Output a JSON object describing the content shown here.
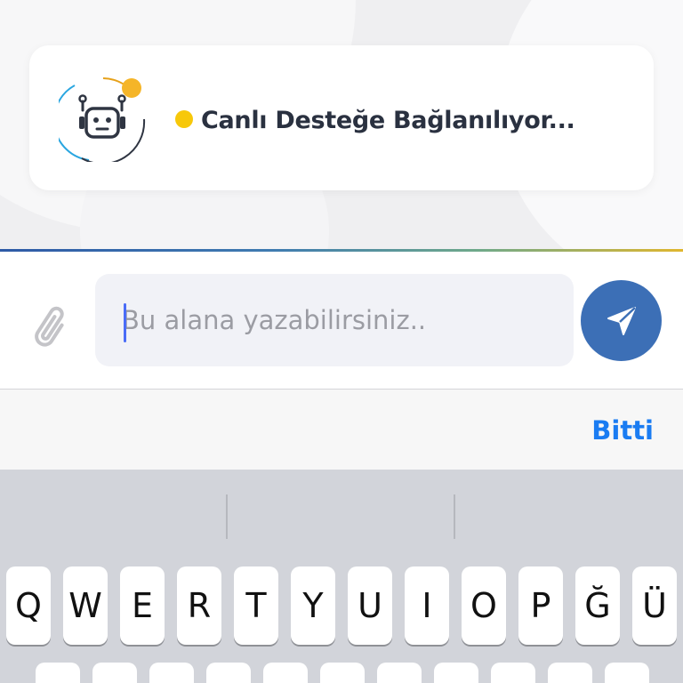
{
  "status": {
    "message": "Canlı Desteğe Bağlanılıyor...",
    "indicator_color": "#f7c80a",
    "avatar_icon": "robot-icon"
  },
  "composer": {
    "placeholder": "Bu alana yazabilirsiniz..",
    "value": "",
    "attach_icon": "paperclip-icon",
    "send_icon": "send-plane-icon",
    "send_color": "#3c6fb6"
  },
  "keyboard_toolbar": {
    "done_label": "Bitti",
    "done_color": "#1a7cf2"
  },
  "keyboard": {
    "row1": [
      "Q",
      "W",
      "E",
      "R",
      "T",
      "Y",
      "U",
      "I",
      "O",
      "P",
      "Ğ",
      "Ü"
    ]
  }
}
